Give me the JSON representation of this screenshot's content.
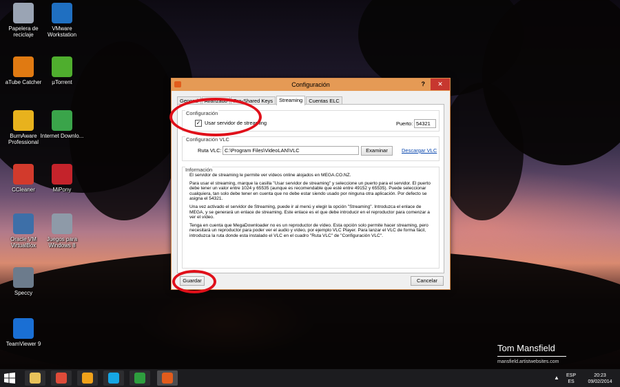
{
  "desktop": {
    "icons": [
      {
        "label": "Papelera de reciclaje",
        "color": "#9aa4b4"
      },
      {
        "label": "VMware Workstation",
        "color": "#1f6fc1"
      },
      {
        "label": "aTube Catcher",
        "color": "#e07a12"
      },
      {
        "label": "µTorrent",
        "color": "#4fae2e"
      },
      {
        "label": "BurnAware Professional",
        "color": "#e8b21d"
      },
      {
        "label": "Internet Downlo...",
        "color": "#3aa44a"
      },
      {
        "label": "CCleaner",
        "color": "#d23a2c"
      },
      {
        "label": "MiPony",
        "color": "#c4232b"
      },
      {
        "label": "Oracle VM VirtualBox",
        "color": "#3d6fa8"
      },
      {
        "label": "Juegos para Windows 8",
        "color": "#8e9aa8"
      },
      {
        "label": "Speccy",
        "color": "#6c7b8c"
      },
      {
        "label": "TeamViewer 9",
        "color": "#1a6fd4"
      }
    ],
    "watermark_name": "Tom Mansfield",
    "watermark_url": "mansfield.artistwebsites.com"
  },
  "dialog": {
    "title": "Configuración",
    "help": "?",
    "close": "✕",
    "tabs": [
      "General",
      "Avanzado",
      "Pre-Shared Keys",
      "Streaming",
      "Cuentas ELC"
    ],
    "active_tab": "Streaming",
    "config_group": "Configuración",
    "enable_streaming_label": "Usar servidor de streaming",
    "enable_streaming_checked": "✓",
    "port_label": "Puerto:",
    "port_value": "54321",
    "vlc_group": "Configuración VLC",
    "vlc_path_label": "Ruta VLC:",
    "vlc_path_value": "C:\\Program Files\\VideoLAN\\VLC",
    "browse_label": "Examinar",
    "download_vlc_link": "Descargar VLC",
    "info_group": "Información",
    "info_paragraphs": [
      "El servidor de streaming le permite ver vídeos online alojados en MEGA.CO.NZ.",
      "Para usar el streaming, marque la casilla \"Usar servidor de streaming\" y seleccione un puerto para el servidor. El puerto debe tener un valor entre 1024 y 65535 (aunque es recomendable que esté entre 49152 y 65535). Puede seleccionar cualquiera, tan solo debe tener en cuenta que no debe estar siendo usado por ninguna otra aplicación. Por defecto se asigna el 54321.",
      "Una vez activado el servidor de Streaming, puede ir al menú y elegir la opción \"Streaming\". Introduzca el enlace de MEGA, y se generará un enlace de streaming. Este enlace es el que debe introducir en el reproductor para comenzar a ver el vídeo.",
      "Tenga en cuenta que MegaDownloader no es un reproductor de vídeo. Esta opción solo permite hacer streaming, pero necesitará un reproductor para poder ver el audio y vídeo, por ejemplo VLC Player. Para lanzar el VLC de forma fácil, introduzca la ruta donde esta instalado el VLC en el cuadro \"Ruta VLC\" de \"Configuración VLC\"."
    ],
    "save_label": "Guardar",
    "cancel_label": "Cancelar"
  },
  "taskbar": {
    "apps": [
      {
        "name": "file-explorer",
        "color": "#e8c25a"
      },
      {
        "name": "chrome",
        "color": "#de4b39"
      },
      {
        "name": "aimp",
        "color": "#f0a21a"
      },
      {
        "name": "skype",
        "color": "#16a6e4"
      },
      {
        "name": "store",
        "color": "#2e9e3e"
      },
      {
        "name": "megadownloader",
        "color": "#e25c1c"
      }
    ],
    "lang_top": "ESP",
    "lang_bottom": "ES",
    "time": "20:23",
    "date": "09/02/2014"
  }
}
